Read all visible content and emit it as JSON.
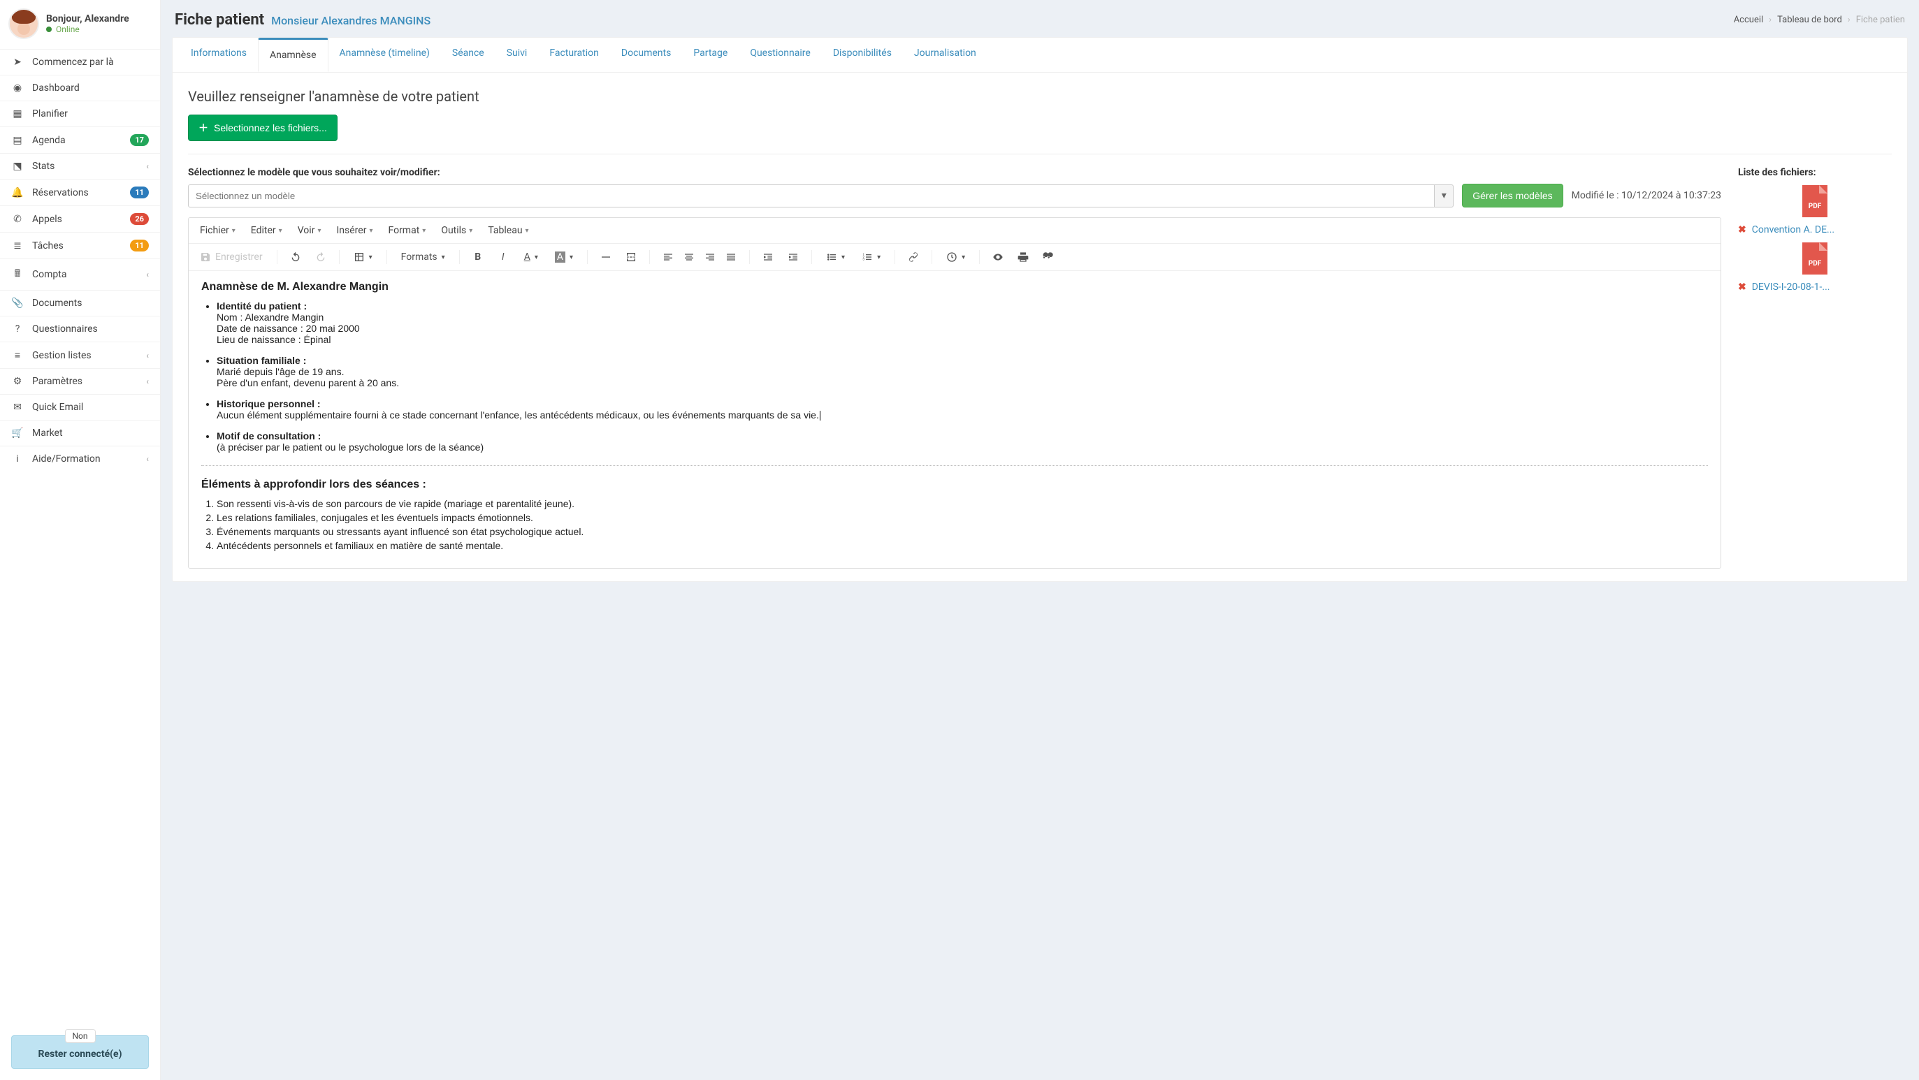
{
  "user": {
    "greeting": "Bonjour, Alexandre",
    "status": "Online"
  },
  "sidebar": {
    "items": [
      {
        "icon": "➤",
        "label": "Commencez par là"
      },
      {
        "icon": "◉",
        "label": "Dashboard"
      },
      {
        "icon": "▦",
        "label": "Planifier"
      },
      {
        "icon": "▤",
        "label": "Agenda",
        "badge": "17",
        "badge_color": "green"
      },
      {
        "icon": "⬔",
        "label": "Stats",
        "chevron": true
      },
      {
        "icon": "🔔",
        "label": "Réservations",
        "badge": "11",
        "badge_color": "blue"
      },
      {
        "icon": "✆",
        "label": "Appels",
        "badge": "26",
        "badge_color": "red"
      },
      {
        "icon": "≣",
        "label": "Tâches",
        "badge": "11",
        "badge_color": "orange"
      },
      {
        "icon": "🖩",
        "label": "Compta",
        "chevron": true
      },
      {
        "icon": "📎",
        "label": "Documents"
      },
      {
        "icon": "?",
        "label": "Questionnaires"
      },
      {
        "icon": "≡",
        "label": "Gestion listes",
        "chevron": true
      },
      {
        "icon": "⚙",
        "label": "Paramètres",
        "chevron": true
      },
      {
        "icon": "✉",
        "label": "Quick Email"
      },
      {
        "icon": "🛒",
        "label": "Market"
      },
      {
        "icon": "i",
        "label": "Aide/Formation",
        "chevron": true
      }
    ],
    "stay": {
      "pill": "Non",
      "label": "Rester connecté(e)"
    }
  },
  "header": {
    "title": "Fiche patient",
    "subtitle": "Monsieur Alexandres MANGINS",
    "breadcrumb": [
      "Accueil",
      "Tableau de bord",
      "Fiche patien"
    ]
  },
  "tabs": [
    "Informations",
    "Anamnèse",
    "Anamnèse (timeline)",
    "Séance",
    "Suivi",
    "Facturation",
    "Documents",
    "Partage",
    "Questionnaire",
    "Disponibilités",
    "Journalisation"
  ],
  "active_tab_index": 1,
  "anamnese": {
    "section_title": "Veuillez renseigner l'anamnèse de votre patient",
    "select_files_btn": "Selectionnez les fichiers...",
    "model_label": "Sélectionnez le modèle que vous souhaitez voir/modifier:",
    "model_placeholder": "Sélectionnez un modèle",
    "manage_models_btn": "Gérer les modèles",
    "modified": "Modifié le : 10/12/2024 à 10:37:23",
    "files_title": "Liste des fichiers:",
    "files": [
      {
        "name": "Convention A. DE..."
      },
      {
        "name": "DEVIS-I-20-08-1-..."
      }
    ]
  },
  "editor": {
    "menus": [
      "Fichier",
      "Editer",
      "Voir",
      "Insérer",
      "Format",
      "Outils",
      "Tableau"
    ],
    "save_label": "Enregistrer",
    "formats_label": "Formats",
    "doc": {
      "title": "Anamnèse de M. Alexandre Mangin",
      "identity_h": "Identité du patient :",
      "identity_lines": [
        "Nom : Alexandre Mangin",
        "Date de naissance : 20 mai 2000",
        "Lieu de naissance : Épinal"
      ],
      "family_h": "Situation familiale :",
      "family_lines": [
        "Marié depuis l'âge de 19 ans.",
        "Père d'un enfant, devenu parent à 20 ans."
      ],
      "history_h": "Historique personnel :",
      "history_line": "Aucun élément supplémentaire fourni à ce stade concernant l'enfance, les antécédents médicaux, ou les événements marquants de sa vie.",
      "motive_h": "Motif de consultation :",
      "motive_line": "(à préciser par le patient ou le psychologue lors de la séance)",
      "deepen_h": "Éléments à approfondir lors des séances :",
      "deepen_items": [
        "Son ressenti vis-à-vis de son parcours de vie rapide (mariage et parentalité jeune).",
        "Les relations familiales, conjugales et les éventuels impacts émotionnels.",
        "Événements marquants ou stressants ayant influencé son état psychologique actuel.",
        "Antécédents personnels et familiaux en matière de santé mentale."
      ]
    }
  }
}
